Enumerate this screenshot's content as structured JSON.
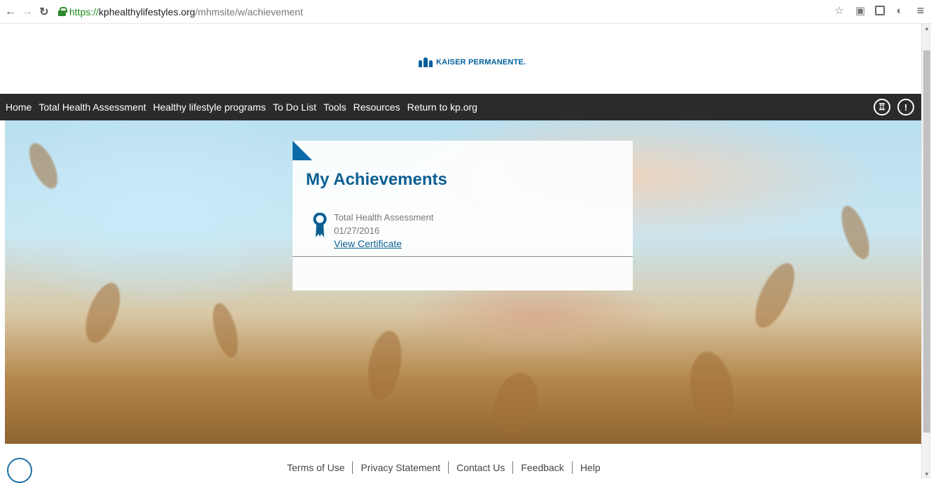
{
  "browser": {
    "url_scheme": "https://",
    "url_host": "kphealthylifestyles.org",
    "url_path": "/mhmsite/w/achievement"
  },
  "header": {
    "logo_text": "KAISER PERMANENTE."
  },
  "nav": {
    "items": [
      {
        "label": "Home"
      },
      {
        "label": "Total Health Assessment"
      },
      {
        "label": "Healthy lifestyle programs"
      },
      {
        "label": "To Do List"
      },
      {
        "label": "Tools"
      },
      {
        "label": "Resources"
      },
      {
        "label": "Return to kp.org"
      }
    ],
    "trophy_symbol": "♖",
    "profile_symbol": "!"
  },
  "card": {
    "title": "My Achievements",
    "achievement": {
      "name": "Total Health Assessment",
      "date": "01/27/2016",
      "link": "View Certificate"
    }
  },
  "footer": {
    "links": [
      "Terms of Use",
      "Privacy Statement",
      "Contact Us",
      "Feedback",
      "Help"
    ]
  },
  "colors": {
    "brand_blue": "#0b5f93",
    "nav_background": "#2b2b2b"
  }
}
